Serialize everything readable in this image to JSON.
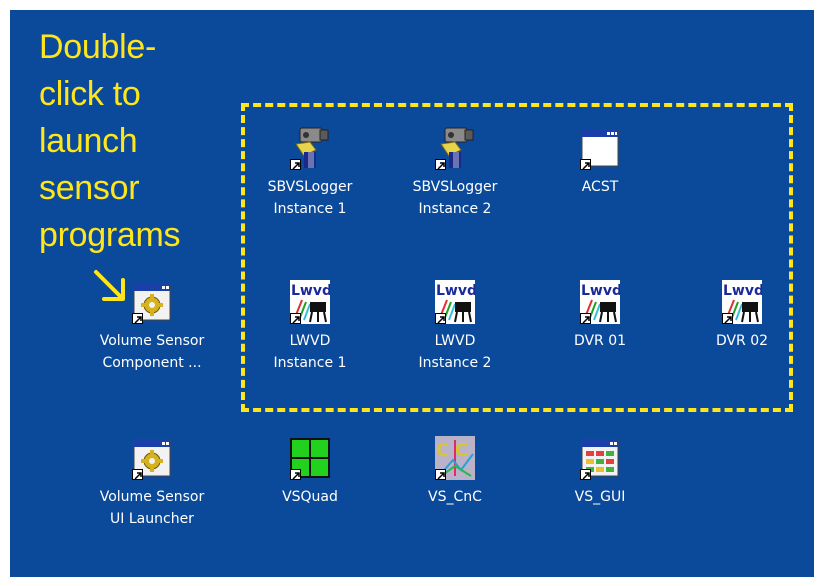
{
  "callout": {
    "lines": [
      "Double-",
      "click to",
      "launch",
      "sensor",
      "programs"
    ]
  },
  "colors": {
    "desktop_background": "#0b4a9a",
    "callout_text": "#ffe61a",
    "selection_border": "#ffe61a"
  },
  "desktop_icons": [
    {
      "label": "SBVSLogger\nInstance 1",
      "icon": "camera-icon"
    },
    {
      "label": "SBVSLogger\nInstance 2",
      "icon": "camera-icon"
    },
    {
      "label": "ACST",
      "icon": "window-icon"
    },
    {
      "label": "Volume Sensor\nComponent ...",
      "icon": "gear-window-icon"
    },
    {
      "label": "LWVD\nInstance 1",
      "icon": "lwvd-icon"
    },
    {
      "label": "LWVD\nInstance 2",
      "icon": "lwvd-icon"
    },
    {
      "label": "DVR 01",
      "icon": "lwvd-icon"
    },
    {
      "label": "DVR 02",
      "icon": "lwvd-icon"
    },
    {
      "label": "Volume Sensor\nUI Launcher",
      "icon": "gear-window-icon"
    },
    {
      "label": "VSQuad",
      "icon": "quad-icon"
    },
    {
      "label": "VS_CnC",
      "icon": "cnc-icon"
    },
    {
      "label": "VS_GUI",
      "icon": "gui-window-icon"
    }
  ]
}
